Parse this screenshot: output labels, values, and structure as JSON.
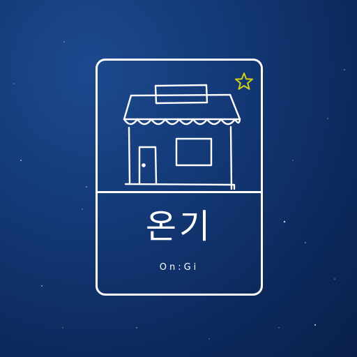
{
  "logo": {
    "korean_name": "온기",
    "latin_name": "On:Gi",
    "icon": "shop-storefront-icon",
    "accent_icon": "star-icon",
    "colors": {
      "background": "#0d2a5e",
      "line": "#ffffff",
      "star": "#d4d11a"
    }
  }
}
